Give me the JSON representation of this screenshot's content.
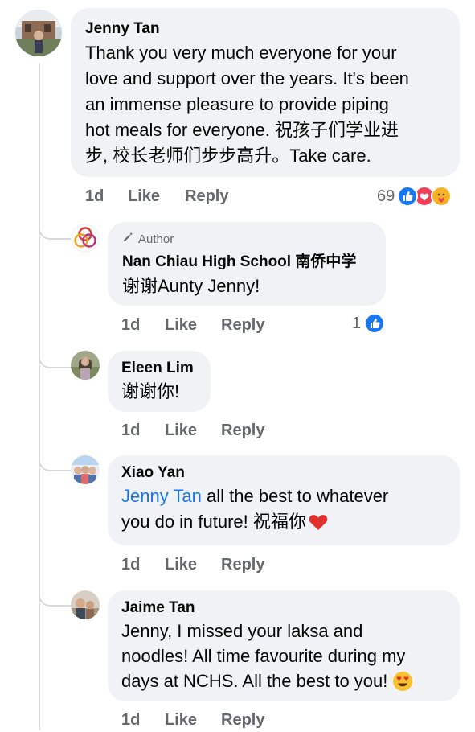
{
  "comments": [
    {
      "author": "Jenny Tan",
      "lines": [
        "Thank you very much everyone for your",
        "love and support over the years. It's been",
        "an immense pleasure to provide piping",
        "hot meals for everyone. 祝孩子们学业进",
        "步, 校长老师们步步高升。Take care."
      ],
      "time": "1d",
      "like": "Like",
      "reply": "Reply",
      "reaction_count": "69"
    },
    {
      "badge": "Author",
      "author": "Nan Chiau High School 南侨中学",
      "text": "谢谢Aunty Jenny!",
      "time": "1d",
      "like": "Like",
      "reply": "Reply",
      "reaction_count": "1"
    },
    {
      "author": "Eleen Lim",
      "text": "谢谢你!",
      "time": "1d",
      "like": "Like",
      "reply": "Reply"
    },
    {
      "author": "Xiao Yan",
      "mention": "Jenny Tan",
      "text_after_mention": " all the best to whatever",
      "line2": "you do in future! 祝福你",
      "time": "1d",
      "like": "Like",
      "reply": "Reply"
    },
    {
      "author": "Jaime Tan",
      "lines": [
        "Jenny, I missed your laksa and",
        "noodles! All time favourite during my",
        "days at NCHS. All the best to you!"
      ],
      "time": "1d",
      "like": "Like",
      "reply": "Reply"
    }
  ],
  "colors": {
    "bubble": "#f0f2f5",
    "secondary_text": "#65676b",
    "mention": "#1b74e4",
    "like_blue": "#1877f2",
    "love_red": "#f33e58"
  }
}
